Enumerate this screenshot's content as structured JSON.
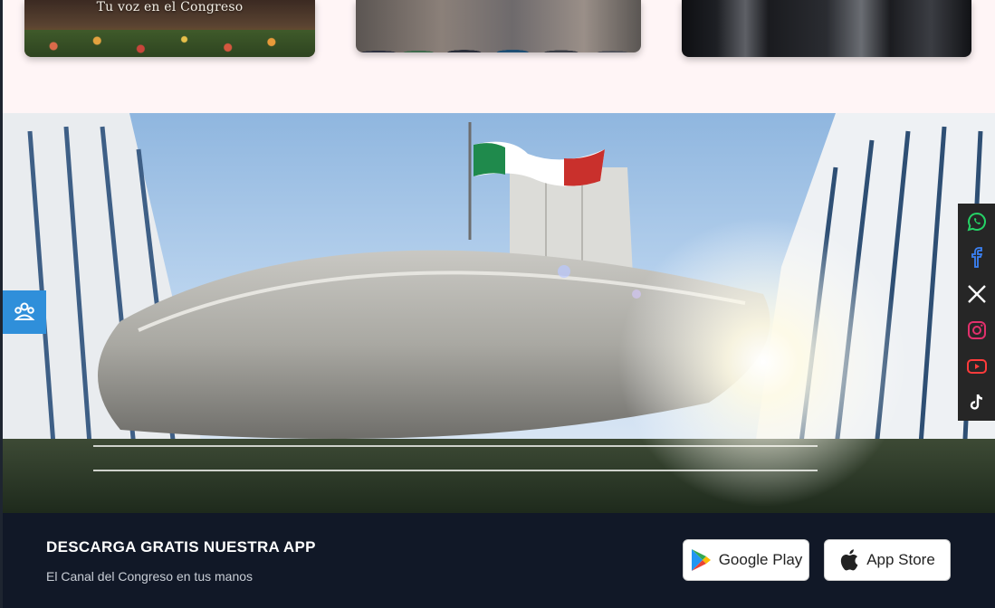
{
  "cards": [
    {
      "caption": "Tu voz en el Congreso"
    },
    {
      "caption": ""
    },
    {
      "caption": ""
    }
  ],
  "app": {
    "title": "DESCARGA GRATIS NUESTRA APP",
    "subtitle": "El Canal del Congreso en tus manos",
    "google_play_label": "Google Play",
    "app_store_label": "App Store"
  },
  "social": [
    {
      "name": "whatsapp-icon",
      "color": "#25d366"
    },
    {
      "name": "facebook-icon",
      "color": "#3b82f6"
    },
    {
      "name": "x-icon",
      "color": "#ffffff"
    },
    {
      "name": "instagram-icon",
      "color": "#e1306c"
    },
    {
      "name": "youtube-icon",
      "color": "#ff3b3b"
    },
    {
      "name": "tiktok-icon",
      "color": "#ffffff"
    }
  ],
  "colors": {
    "accent_blue": "#2f8fda",
    "band_dark": "#111827"
  }
}
